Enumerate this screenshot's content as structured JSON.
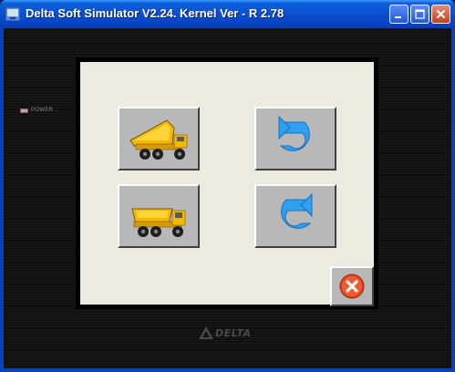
{
  "window": {
    "title": "Delta Soft Simulator V2.24. Kernel Ver - R 2.78"
  },
  "panel": {
    "power_label": "POWER",
    "brand": "DELTA"
  },
  "buttons": [
    {
      "name": "dump-truck-tipping-button",
      "icon": "dump-truck-tipped-icon"
    },
    {
      "name": "rotate-back-button",
      "icon": "rotate-counterclockwise-icon"
    },
    {
      "name": "dump-truck-flat-button",
      "icon": "dump-truck-flat-icon"
    },
    {
      "name": "rotate-forward-button",
      "icon": "rotate-clockwise-icon"
    },
    {
      "name": "close-screen-button",
      "icon": "close-x-icon"
    }
  ],
  "colors": {
    "titlebar": "#0a4fd0",
    "screen_bg": "#ecebdf",
    "button_face": "#b8b8b8",
    "truck_yellow": "#f5b800",
    "arrow_blue": "#2f9ff0",
    "close_red": "#e0401a"
  }
}
